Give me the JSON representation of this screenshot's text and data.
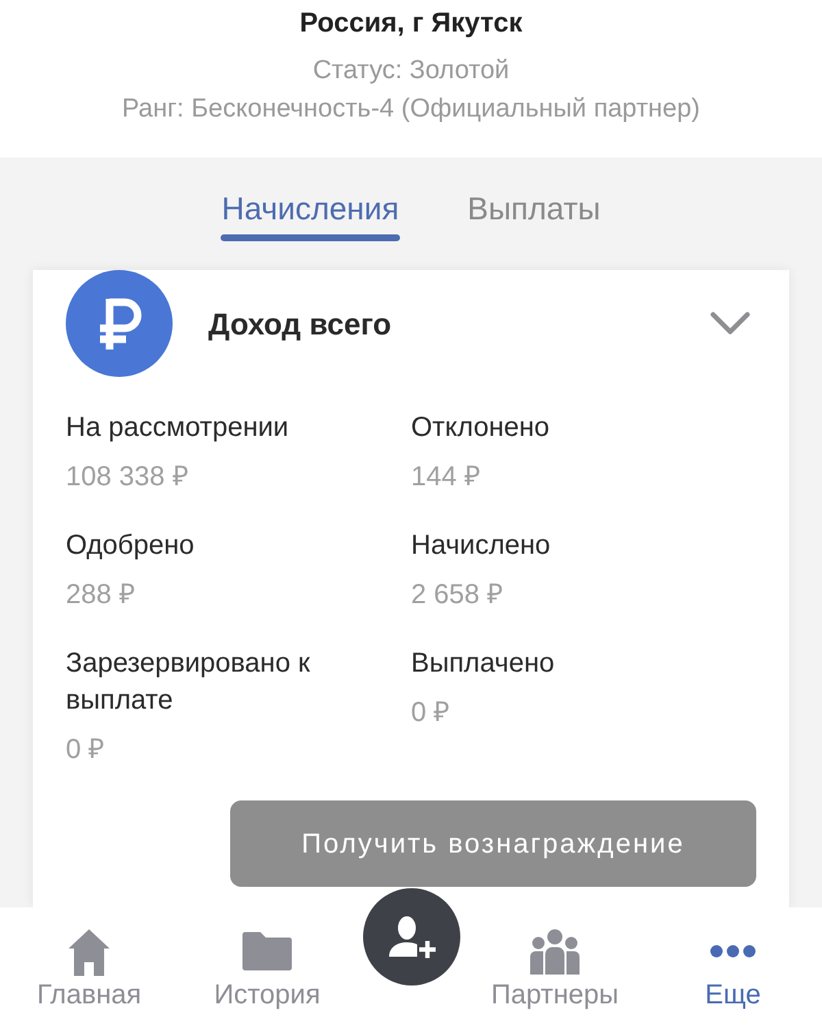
{
  "header": {
    "location": "Россия, г Якутск",
    "status": "Статус: Золотой",
    "rank": "Ранг: Бесконечность-4 (Официальный партнер)"
  },
  "tabs": [
    {
      "label": "Начисления",
      "selected": true
    },
    {
      "label": "Выплаты",
      "selected": false
    }
  ],
  "income_card": {
    "title": "Доход всего",
    "stats": [
      {
        "label": "На рассмотрении",
        "value": "108 338 ₽"
      },
      {
        "label": "Отклонено",
        "value": "144 ₽"
      },
      {
        "label": "Одобрено",
        "value": "288 ₽"
      },
      {
        "label": "Начислено",
        "value": "2 658 ₽"
      },
      {
        "label": "Зарезервировано к выплате",
        "value": "0 ₽"
      },
      {
        "label": "Выплачено",
        "value": "0 ₽"
      }
    ],
    "reward_button": {
      "label": "Получить вознаграждение",
      "disabled": true
    }
  },
  "bottom_nav": [
    {
      "label": "Главная",
      "selected": false
    },
    {
      "label": "История",
      "selected": false
    },
    {
      "label": "Партнеры",
      "selected": false
    },
    {
      "label": "Еще",
      "selected": true
    }
  ]
}
